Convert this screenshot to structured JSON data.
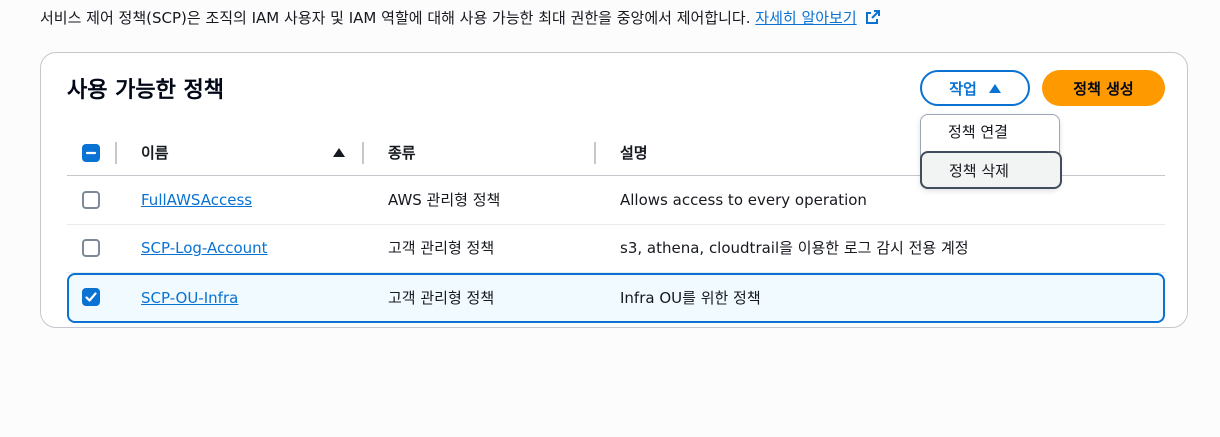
{
  "description": {
    "text": "서비스 제어 정책(SCP)은 조직의 IAM 사용자 및 IAM 역할에 대해 사용 가능한 최대 권한을 중앙에서 제어합니다.",
    "learn_more": "자세히 알아보기"
  },
  "policies_panel": {
    "title": "사용 가능한 정책",
    "actions_label": "작업",
    "create_label": "정책 생성",
    "actions_menu": [
      {
        "label": "정책 연결"
      },
      {
        "label": "정책 삭제"
      }
    ],
    "columns": {
      "name": "이름",
      "type": "종류",
      "description": "설명"
    },
    "rows": [
      {
        "name": "FullAWSAccess",
        "type": "AWS 관리형 정책",
        "description": "Allows access to every operation",
        "selected": false
      },
      {
        "name": "SCP-Log-Account",
        "type": "고객 관리형 정책",
        "description": "s3, athena, cloudtrail을 이용한 로그 감시 전용 계정",
        "selected": false
      },
      {
        "name": "SCP-OU-Infra",
        "type": "고객 관리형 정책",
        "description": "Infra OU를 위한 정책",
        "selected": true
      }
    ]
  },
  "colors": {
    "accent": "#0972d3",
    "primary_button": "#ff9900",
    "selected_row_bg": "#f1faff"
  }
}
